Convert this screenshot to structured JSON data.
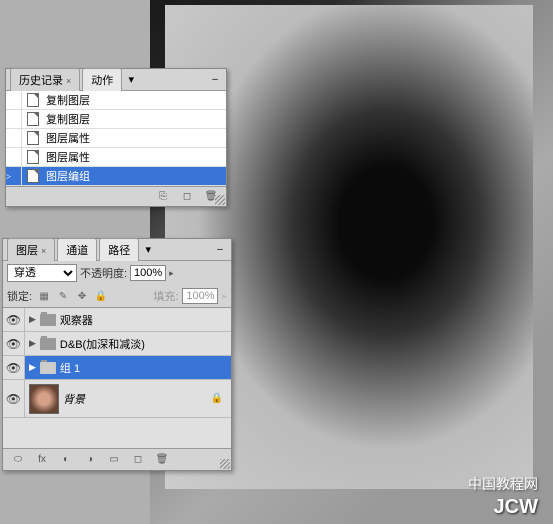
{
  "canvas": {
    "watermark1": "中国教程网",
    "watermark2": "JCW"
  },
  "history": {
    "tabs": [
      "历史记录",
      "动作"
    ],
    "items": [
      {
        "label": "复制图层",
        "icon": "doc"
      },
      {
        "label": "复制图层",
        "icon": "doc"
      },
      {
        "label": "图层属性",
        "icon": "doc"
      },
      {
        "label": "图层属性",
        "icon": "doc"
      },
      {
        "label": "图层编组",
        "icon": "doc",
        "selected": true,
        "marker": true
      }
    ]
  },
  "layers": {
    "tabs": [
      "图层",
      "通道",
      "路径"
    ],
    "blend_mode": "穿透",
    "opacity_label": "不透明度:",
    "opacity_value": "100%",
    "lock_label": "锁定:",
    "fill_label": "填充:",
    "fill_value": "100%",
    "items": [
      {
        "name": "观察器",
        "type": "folder",
        "visible": true
      },
      {
        "name": "D&B(加深和减淡)",
        "type": "folder",
        "visible": true
      },
      {
        "name": "组 1",
        "type": "folder",
        "visible": true,
        "selected": true
      },
      {
        "name": "背景",
        "type": "bg",
        "visible": true,
        "locked": true
      }
    ]
  }
}
